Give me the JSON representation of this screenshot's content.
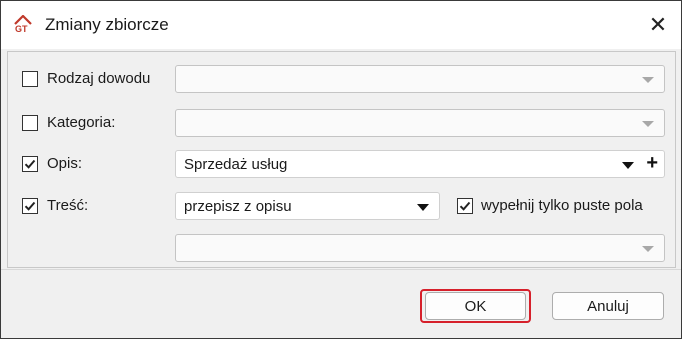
{
  "window": {
    "title": "Zmiany zbiorcze",
    "app_icon": "gt-logo-icon",
    "close_glyph": "✕"
  },
  "rows": {
    "rodzaj": {
      "label": "Rodzaj dowodu",
      "checked": false,
      "value": ""
    },
    "kategoria": {
      "label": "Kategoria:",
      "checked": false,
      "value": ""
    },
    "opis": {
      "label": "Opis:",
      "checked": true,
      "value": "Sprzedaż usług",
      "add_glyph": "+"
    },
    "tresc": {
      "label": "Treść:",
      "checked": true,
      "value": "przepisz z opisu"
    },
    "extra": {
      "value": ""
    }
  },
  "fill_empty": {
    "label": "wypełnij tylko puste pola",
    "checked": true
  },
  "buttons": {
    "ok": "OK",
    "cancel": "Anuluj"
  },
  "colors": {
    "highlight": "#d6202b",
    "logo": "#c0392b"
  }
}
